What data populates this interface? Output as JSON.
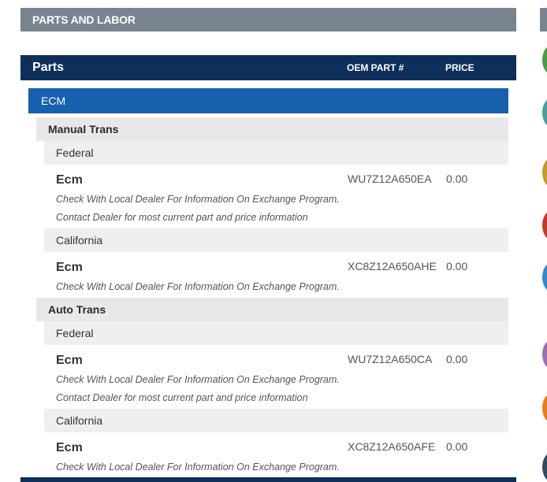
{
  "section": {
    "title": "PARTS AND LABOR"
  },
  "table": {
    "title": "Parts",
    "col_oem": "OEM PART #",
    "col_price": "PRICE"
  },
  "category": {
    "label": "ECM"
  },
  "groups": [
    {
      "label": "Manual Trans",
      "regions": [
        {
          "label": "Federal",
          "part": {
            "name": "Ecm",
            "oem": "WU7Z12A650EA",
            "price": "0.00",
            "notes": [
              "Check With Local Dealer For Information On Exchange Program.",
              "Contact Dealer for most current part and price information"
            ]
          }
        },
        {
          "label": "California",
          "part": {
            "name": "Ecm",
            "oem": "XC8Z12A650AHE",
            "price": "0.00",
            "notes": [
              "Check With Local Dealer For Information On Exchange Program."
            ]
          }
        }
      ]
    },
    {
      "label": "Auto Trans",
      "regions": [
        {
          "label": "Federal",
          "part": {
            "name": "Ecm",
            "oem": "WU7Z12A650CA",
            "price": "0.00",
            "notes": [
              "Check With Local Dealer For Information On Exchange Program.",
              "Contact Dealer for most current part and price information"
            ]
          }
        },
        {
          "label": "California",
          "part": {
            "name": "Ecm",
            "oem": "XC8Z12A650AFE",
            "price": "0.00",
            "notes": [
              "Check With Local Dealer For Information On Exchange Program."
            ]
          }
        }
      ]
    }
  ],
  "side_dots": [
    {
      "color": "#4a9a48"
    },
    {
      "color": "#4f9a9a"
    },
    {
      "color": "#c59a2e"
    },
    {
      "color": "#c0392b"
    },
    {
      "color": "#3a86c8"
    },
    {
      "color": "#9b6fb0"
    },
    {
      "color": "#e67e22"
    },
    {
      "color": "#34495e"
    }
  ]
}
